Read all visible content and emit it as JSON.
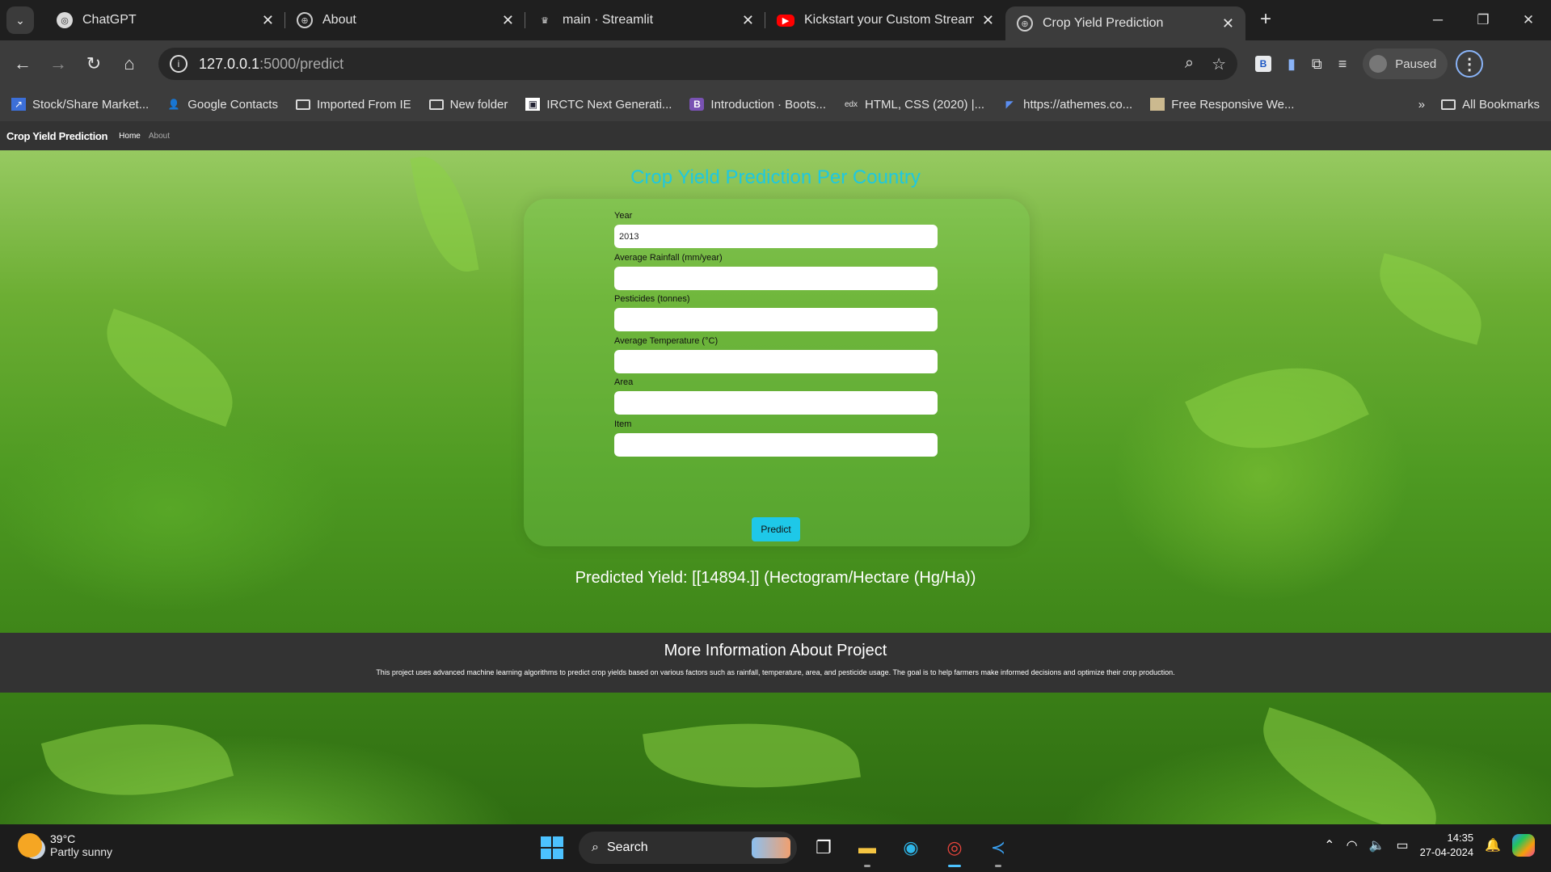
{
  "browser": {
    "tabs": [
      {
        "title": "ChatGPT",
        "icon": "chatgpt-icon",
        "active": false
      },
      {
        "title": "About",
        "icon": "globe-icon",
        "active": false
      },
      {
        "title": "main · Streamlit",
        "icon": "streamlit-icon",
        "active": false
      },
      {
        "title": "Kickstart your Custom Streamlit",
        "icon": "youtube-icon",
        "active": false
      },
      {
        "title": "Crop Yield Prediction",
        "icon": "globe-icon",
        "active": true
      }
    ],
    "url_host": "127.0.0.1",
    "url_path": ":5000/predict",
    "profile_status": "Paused",
    "bookmarks": [
      "Stock/Share Market...",
      "Google Contacts",
      "Imported From IE",
      "New folder",
      "IRCTC Next Generati...",
      "Introduction · Boots...",
      "HTML, CSS (2020) |...",
      "https://athemes.co...",
      "Free Responsive We..."
    ],
    "all_bookmarks": "All Bookmarks"
  },
  "app": {
    "brand": "Crop Yield Prediction",
    "nav_home": "Home",
    "nav_about": "About",
    "heading": "Crop Yield Prediction Per Country",
    "fields": {
      "year_label": "Year",
      "year_value": "2013",
      "rainfall_label": "Average Rainfall (mm/year)",
      "rainfall_value": "",
      "pesticides_label": "Pesticides (tonnes)",
      "pesticides_value": "",
      "temperature_label": "Average Temperature (°C)",
      "temperature_value": "",
      "area_label": "Area",
      "area_value": "",
      "item_label": "Item",
      "item_value": ""
    },
    "predict_label": "Predict",
    "result": "Predicted Yield: [[14894.]] (Hectogram/Hectare (Hg/Ha))",
    "info_title": "More Information About Project",
    "info_text": "This project uses advanced machine learning algorithms to predict crop yields based on various factors such as rainfall, temperature, area, and pesticide usage. The goal is to help farmers make informed decisions and optimize their crop production."
  },
  "taskbar": {
    "temperature": "39°C",
    "weather": "Partly sunny",
    "search_label": "Search",
    "time": "14:35",
    "date": "27-04-2024"
  },
  "colors": {
    "accent": "#1ec8e0",
    "nav_bg": "#333333"
  }
}
